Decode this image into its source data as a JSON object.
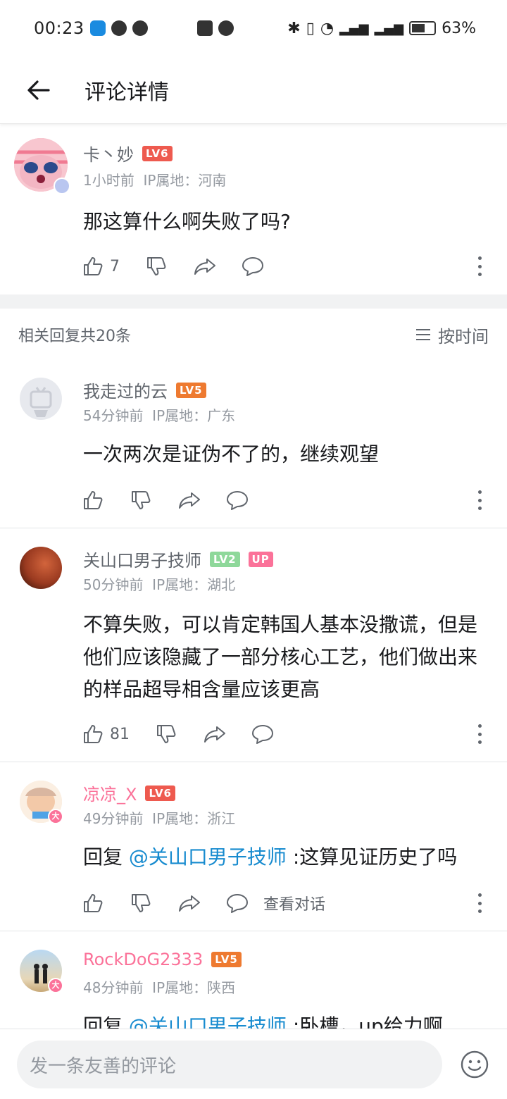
{
  "status_bar": {
    "time": "00:23",
    "battery": "63%"
  },
  "header": {
    "title": "评论详情"
  },
  "main_comment": {
    "username": "卡丶妙",
    "level": "LV6",
    "time": "1小时前",
    "ip": "IP属地：河南",
    "text": "那这算什么啊失败了吗?",
    "likes": "7"
  },
  "replies_header": {
    "count": "相关回复共20条",
    "sort": "按时间"
  },
  "replies": [
    {
      "username": "我走过的云",
      "level": "LV5",
      "time": "54分钟前",
      "ip": "IP属地：广东",
      "text": "一次两次是证伪不了的，继续观望",
      "likes": ""
    },
    {
      "username": "关山口男子技师",
      "level": "LV2",
      "badge": "UP",
      "time": "50分钟前",
      "ip": "IP属地：湖北",
      "text": "不算失败，可以肯定韩国人基本没撒谎，但是他们应该隐藏了一部分核心工艺，他们做出来的样品超导相含量应该更高",
      "likes": "81"
    },
    {
      "username": "凉凉_X",
      "level": "LV6",
      "time": "49分钟前",
      "ip": "IP属地：浙江",
      "reply_prefix": "回复 ",
      "mention": "@关山口男子技师",
      "text": " :这算见证历史了吗",
      "view_conversation": "查看对话"
    },
    {
      "username": "RockDoG2333",
      "level": "LV5",
      "time": "48分钟前",
      "ip": "IP属地：陕西",
      "reply_prefix": "回复 ",
      "mention": "@关山口男子技师",
      "text": " :卧槽，up给力啊"
    }
  ],
  "bottom": {
    "placeholder": "发一条友善的评论"
  },
  "colors": {
    "accent_pink": "#fb7299",
    "link_blue": "#178bcf",
    "lv6": "#ee5a4f",
    "lv5": "#ee7a30",
    "lv2": "#8ed89a",
    "up_badge": "#fb7299"
  }
}
